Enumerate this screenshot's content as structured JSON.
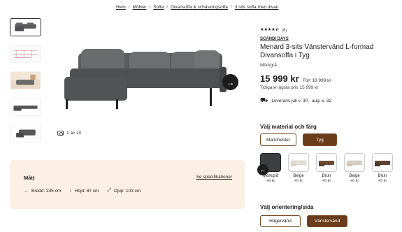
{
  "breadcrumb": [
    "Hem",
    "Möbler",
    "Soffa",
    "Divansoffa & schäslongsoffa",
    "3 sits soffa med divan"
  ],
  "gallery": {
    "counter": "1 av 10",
    "next_icon": "arrow-right-icon"
  },
  "dimensions": {
    "title": "Mått",
    "spec_link": "Se specifikationer",
    "width": "Bredd: 245 cm",
    "height": "Höjd: 87 cm",
    "depth": "Djup: 103 cm"
  },
  "product": {
    "rating_count": "(6)",
    "rating": 4.5,
    "brand": "SCANDI DAYS",
    "title": "Menard 3-sits Vänstervänd L-formad Divansoffa i Tyg",
    "variant": "Mörkgrå",
    "price": "15 999 kr",
    "previous_price": "Förr 18 999 kr",
    "lowest_price": "Tidigare lägsta pris 15 999 kr",
    "delivery": "Leverans juli v. 30 - aug. v. 32"
  },
  "material_section": {
    "title": "Välj material och färg",
    "materials": [
      {
        "label": "Manchester",
        "active": false
      },
      {
        "label": "Tyg",
        "active": true
      }
    ],
    "swatches": [
      {
        "name": "Mörkgrå",
        "price": "+0 kr",
        "color": "#4a4b4d",
        "active": true
      },
      {
        "name": "Beige",
        "price": "+0 kr",
        "color": "#e3ddd3",
        "active": false
      },
      {
        "name": "Brun",
        "price": "+0 kr",
        "color": "#6b4a35",
        "active": false
      },
      {
        "name": "Beige",
        "price": "+0 kr",
        "color": "#d8cfc2",
        "active": false
      },
      {
        "name": "Brun",
        "price": "+0 kr",
        "color": "#5d4232",
        "active": false
      }
    ]
  },
  "orientation_section": {
    "title": "Välj orientering/sida",
    "options": [
      {
        "label": "Högervänd",
        "active": false
      },
      {
        "label": "Vänstervänd",
        "active": true
      }
    ]
  },
  "colors": {
    "accent": "#6b3c1a",
    "panel": "#fcefe4"
  }
}
